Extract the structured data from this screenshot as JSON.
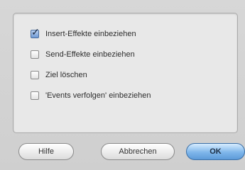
{
  "options": [
    {
      "label": "Insert-Effekte einbeziehen",
      "checked": true
    },
    {
      "label": "Send-Effekte einbeziehen",
      "checked": false
    },
    {
      "label": "Ziel löschen",
      "checked": false
    },
    {
      "label": "'Events verfolgen' einbeziehen",
      "checked": false
    }
  ],
  "buttons": {
    "help_label": "Hilfe",
    "cancel_label": "Abbrechen",
    "ok_label": "OK"
  },
  "colors": {
    "accent": "#6f99d3",
    "default_button": "#7fb6ea"
  }
}
